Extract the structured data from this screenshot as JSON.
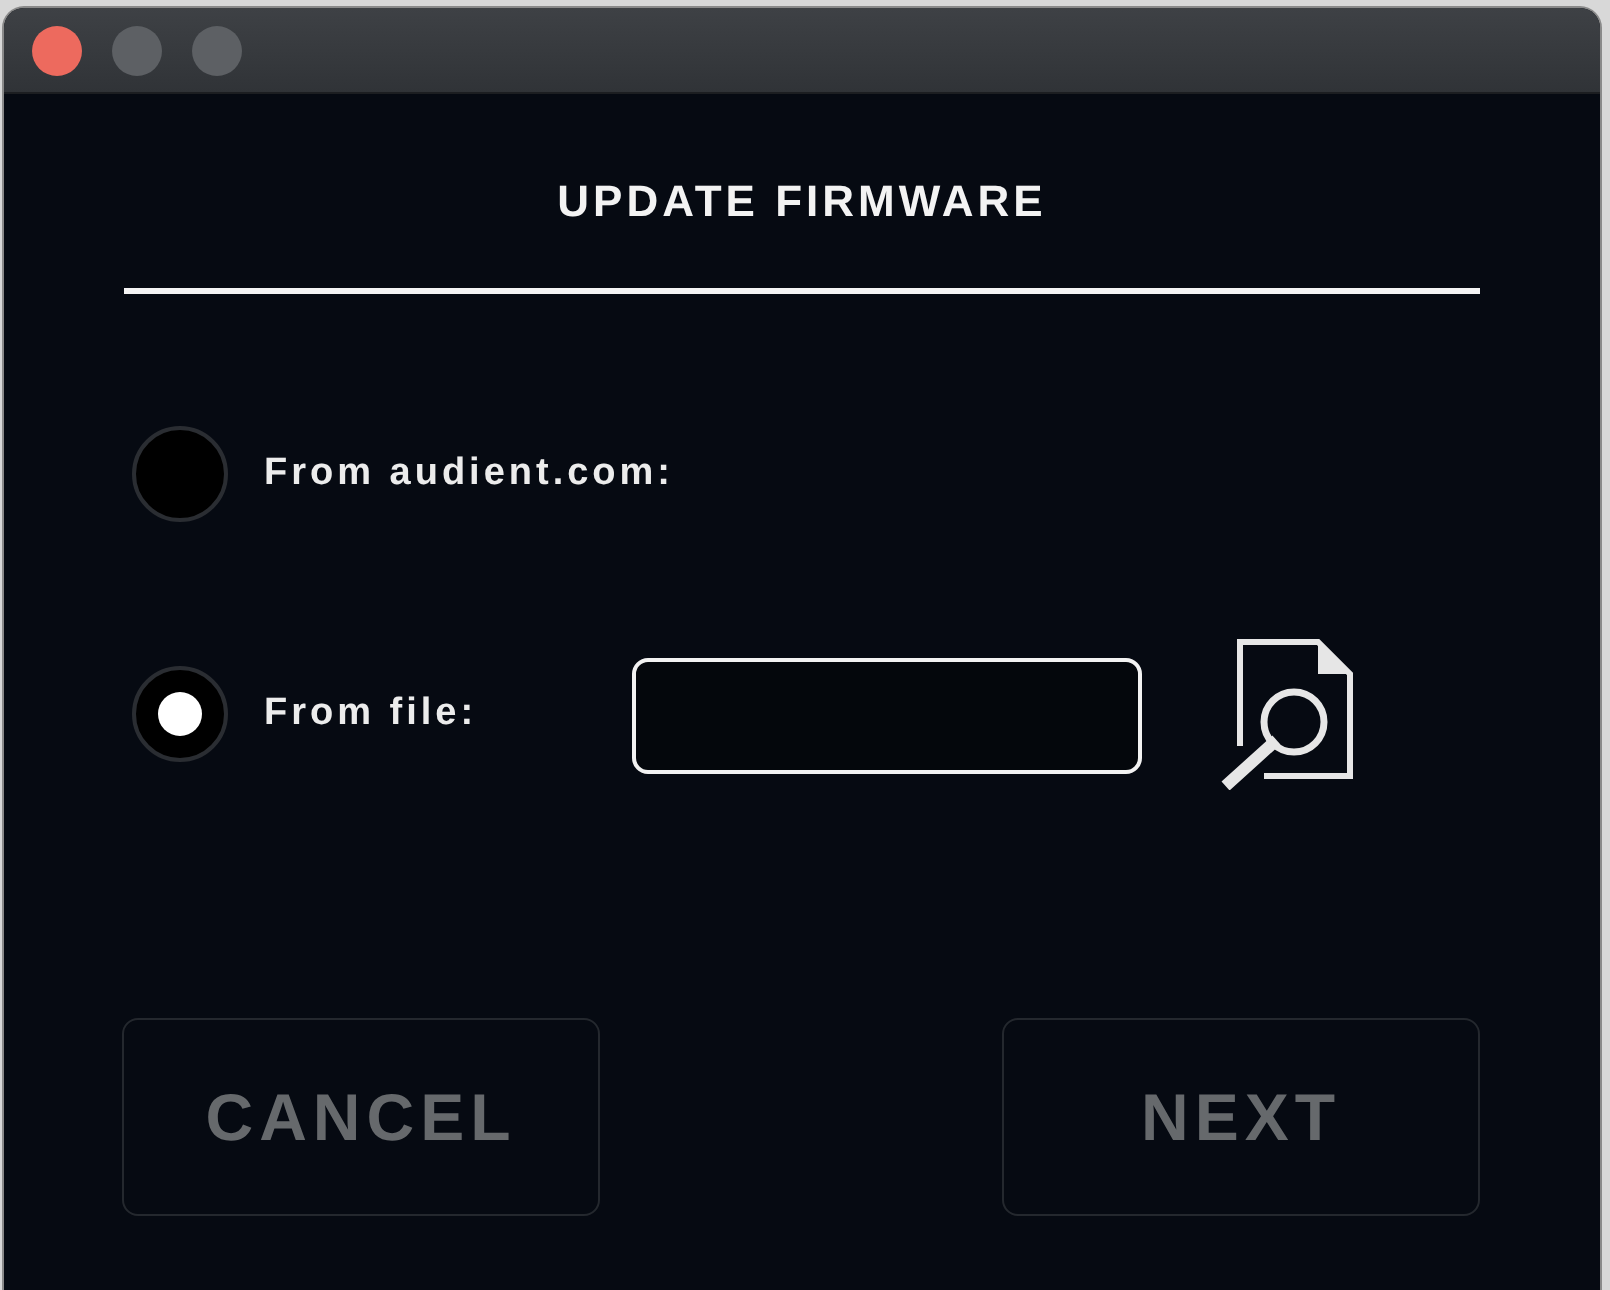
{
  "window": {
    "controls": [
      {
        "kind": "close",
        "disabled": false
      },
      {
        "kind": "minimize",
        "disabled": true
      },
      {
        "kind": "zoom",
        "disabled": true
      }
    ]
  },
  "heading": "UPDATE FIRMWARE",
  "options": [
    {
      "kind": "plain",
      "label": "From audient.com:",
      "selected": false
    },
    {
      "kind": "file",
      "label": "From file:",
      "selected": true
    }
  ],
  "buttons": [
    {
      "label": "CANCEL",
      "disabled": true
    },
    {
      "label": "NEXT",
      "disabled": true
    }
  ]
}
